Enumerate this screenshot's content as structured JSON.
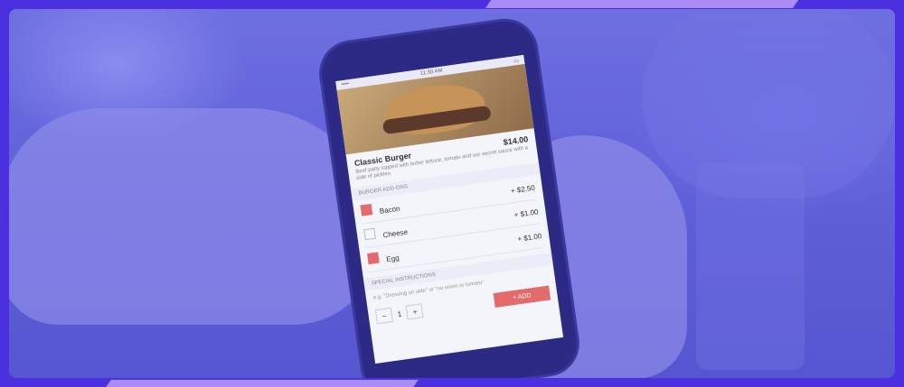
{
  "app": {
    "status_time": "11:30 AM",
    "item": {
      "title": "Classic Burger",
      "price": "$14.00",
      "description": "Beef patty topped with butter lettuce, tomato and our secret sauce with a side of pickles."
    },
    "addons_header": "BURGER ADD-ONS",
    "addons": [
      {
        "label": "Bacon",
        "price": "+ $2.50",
        "checked": true
      },
      {
        "label": "Cheese",
        "price": "+ $1.00",
        "checked": false
      },
      {
        "label": "Egg",
        "price": "+ $1.00",
        "checked": true
      }
    ],
    "special_header": "SPECIAL INSTRUCTIONS",
    "special_placeholder": "e.g. \"Dressing on side\" or \"no onion or tomato\"",
    "quantity": "1",
    "add_label": "+ ADD"
  },
  "colors": {
    "brand": "#4a30df",
    "accent": "#a98cf5",
    "button": "#e46b6b"
  }
}
